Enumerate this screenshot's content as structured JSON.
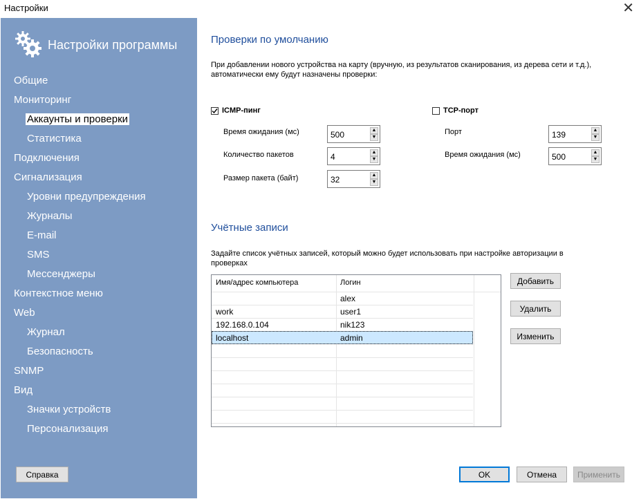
{
  "window": {
    "title": "Настройки",
    "close_glyph": "✕"
  },
  "sidebar": {
    "title": "Настройки программы",
    "icon": "gears-icon",
    "items": [
      {
        "label": "Общие"
      },
      {
        "label": "Мониторинг"
      },
      {
        "label": "Аккаунты и проверки"
      },
      {
        "label": "Статистика"
      },
      {
        "label": "Подключения"
      },
      {
        "label": "Сигнализация"
      },
      {
        "label": "Уровни предупреждения"
      },
      {
        "label": "Журналы"
      },
      {
        "label": "E-mail"
      },
      {
        "label": "SMS"
      },
      {
        "label": "Мессенджеры"
      },
      {
        "label": "Контекстное меню"
      },
      {
        "label": "Web"
      },
      {
        "label": "Журнал"
      },
      {
        "label": "Безопасность"
      },
      {
        "label": "SNMP"
      },
      {
        "label": "Вид"
      },
      {
        "label": "Значки устройств"
      },
      {
        "label": "Персонализация"
      }
    ],
    "selected": "Аккаунты и проверки",
    "help_button": "Справка",
    "background_color": "#7d9bc4"
  },
  "defaults": {
    "title": "Проверки по умолчанию",
    "description_line1": "При добавлении нового устройства на карту (вручную, из результатов сканирования, из дерева сети и т.д.),",
    "description_line2": "автоматически ему будут назначены проверки:",
    "icmp": {
      "label": "ICMP-пинг",
      "checked": true,
      "timeout_label": "Время ожидания (мс)",
      "timeout_value": "500",
      "packets_label": "Количество пакетов",
      "packets_value": "4",
      "size_label": "Размер пакета (байт)",
      "size_value": "32"
    },
    "tcp": {
      "label": "TCP-порт",
      "checked": false,
      "port_label": "Порт",
      "port_value": "139",
      "timeout_label": "Время ожидания (мс)",
      "timeout_value": "500"
    }
  },
  "accounts": {
    "title": "Учётные записи",
    "description_line1": "Задайте список учётных записей, который можно будет использовать при настройке авторизации в",
    "description_line2": "проверках",
    "columns": [
      "Имя/адрес компьютера",
      "Логин"
    ],
    "rows": [
      {
        "host": "",
        "login": "alex"
      },
      {
        "host": "work",
        "login": "user1"
      },
      {
        "host": "192.168.0.104",
        "login": "nik123"
      },
      {
        "host": "localhost",
        "login": "admin"
      }
    ],
    "selected_row": 3,
    "add_button": "Добавить",
    "delete_button": "Удалить",
    "edit_button": "Изменить"
  },
  "footer": {
    "ok": "OK",
    "cancel": "Отмена",
    "apply": "Применить"
  },
  "colors": {
    "heading": "#1f4e9c",
    "accent": "#0078d7",
    "selection": "#cce8ff"
  }
}
